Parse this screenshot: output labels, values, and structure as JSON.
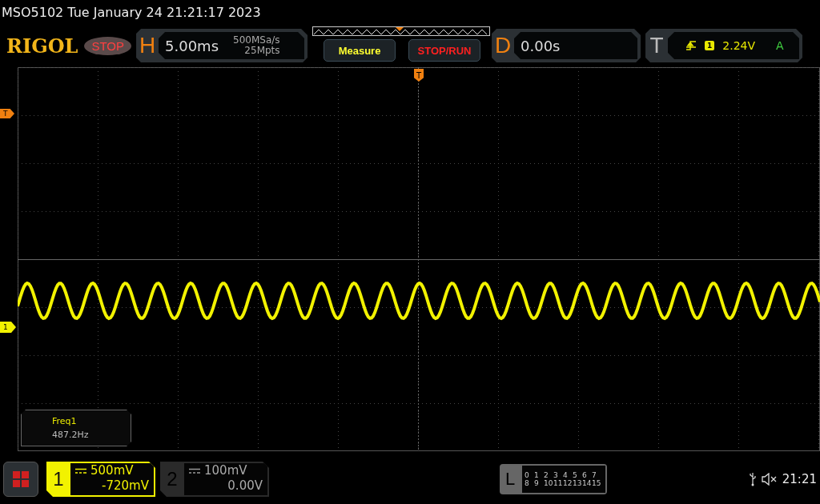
{
  "title_bar": {
    "text": "MSO5102  Tue January 24 21:21:17 2023"
  },
  "logo": "RIGOL",
  "run_status": "STOP",
  "horizontal": {
    "label": "H",
    "timebase": "5.00ms",
    "sample_rate": "500MSa/s",
    "memory_depth": "25Mpts"
  },
  "buttons": [
    {
      "label": "Measure",
      "kind": "measure"
    },
    {
      "label": "STOP/RUN",
      "kind": "run"
    }
  ],
  "delay": {
    "label": "D",
    "value": "0.00s"
  },
  "trigger": {
    "label": "T",
    "source": "1",
    "level": "2.24V",
    "mode": "A"
  },
  "markers": {
    "trigger_position": "T",
    "trigger_level": "T",
    "channel": "1"
  },
  "measurement": {
    "name": "Freq1",
    "value": "487.2Hz"
  },
  "channels": [
    {
      "number": "1",
      "scale": "500mV",
      "offset": "-720mV",
      "selected": true
    },
    {
      "number": "2",
      "scale": "100mV",
      "offset": "0.00V",
      "selected": false
    }
  ],
  "logic": {
    "label": "L",
    "rows": [
      [
        "0",
        "1",
        "2",
        "3",
        "4",
        "5",
        "6",
        "7"
      ],
      [
        "8",
        "9",
        "10",
        "11",
        "12",
        "13",
        "14",
        "15"
      ]
    ]
  },
  "status_bar": {
    "time": "21:21"
  }
}
